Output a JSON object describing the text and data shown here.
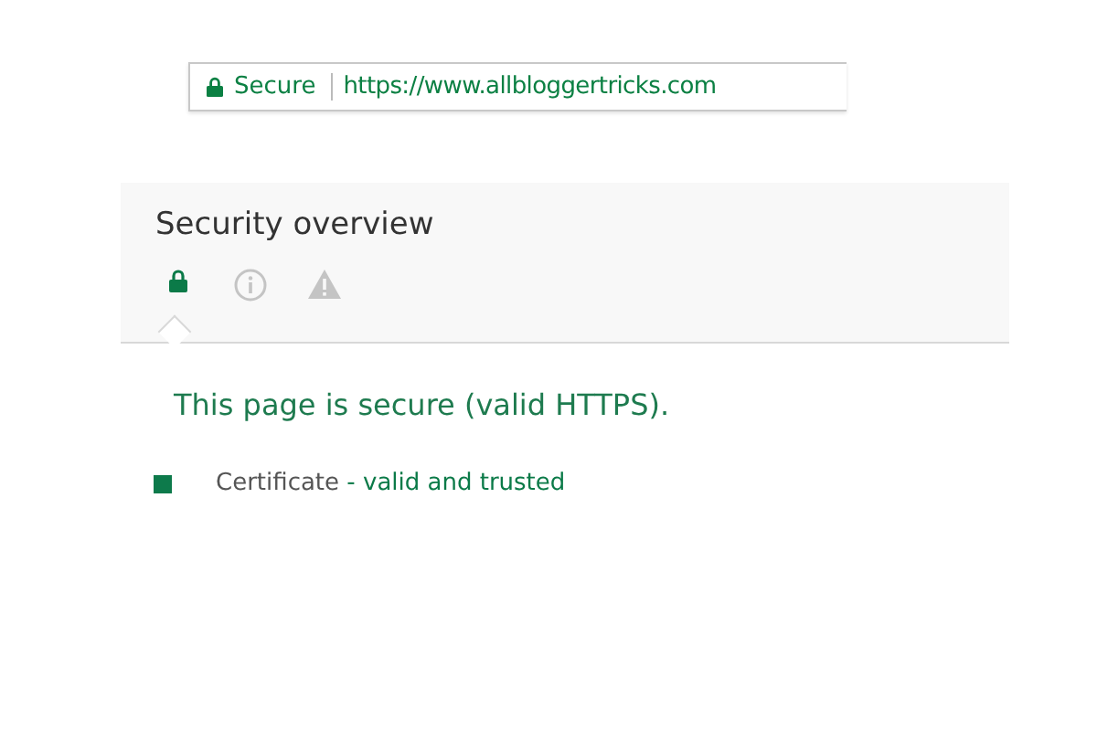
{
  "address_bar": {
    "security_label": "Secure",
    "url": "https://www.allbloggertricks.com"
  },
  "panel": {
    "title": "Security overview",
    "tabs": [
      {
        "kind": "lock",
        "selected": true
      },
      {
        "kind": "info",
        "selected": false
      },
      {
        "kind": "warning",
        "selected": false
      }
    ]
  },
  "summary": "This page is secure (valid HTTPS).",
  "details": [
    {
      "label": "Certificate",
      "value": "- valid and trusted",
      "color": "#0d7a4b"
    }
  ]
}
